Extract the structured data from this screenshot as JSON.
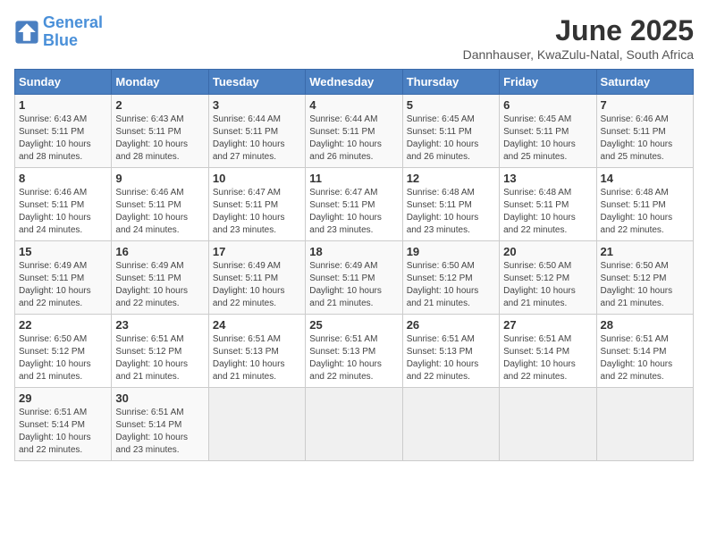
{
  "logo": {
    "line1": "General",
    "line2": "Blue"
  },
  "title": "June 2025",
  "subtitle": "Dannhauser, KwaZulu-Natal, South Africa",
  "days_of_week": [
    "Sunday",
    "Monday",
    "Tuesday",
    "Wednesday",
    "Thursday",
    "Friday",
    "Saturday"
  ],
  "weeks": [
    [
      {
        "day": "1",
        "info": "Sunrise: 6:43 AM\nSunset: 5:11 PM\nDaylight: 10 hours\nand 28 minutes."
      },
      {
        "day": "2",
        "info": "Sunrise: 6:43 AM\nSunset: 5:11 PM\nDaylight: 10 hours\nand 28 minutes."
      },
      {
        "day": "3",
        "info": "Sunrise: 6:44 AM\nSunset: 5:11 PM\nDaylight: 10 hours\nand 27 minutes."
      },
      {
        "day": "4",
        "info": "Sunrise: 6:44 AM\nSunset: 5:11 PM\nDaylight: 10 hours\nand 26 minutes."
      },
      {
        "day": "5",
        "info": "Sunrise: 6:45 AM\nSunset: 5:11 PM\nDaylight: 10 hours\nand 26 minutes."
      },
      {
        "day": "6",
        "info": "Sunrise: 6:45 AM\nSunset: 5:11 PM\nDaylight: 10 hours\nand 25 minutes."
      },
      {
        "day": "7",
        "info": "Sunrise: 6:46 AM\nSunset: 5:11 PM\nDaylight: 10 hours\nand 25 minutes."
      }
    ],
    [
      {
        "day": "8",
        "info": "Sunrise: 6:46 AM\nSunset: 5:11 PM\nDaylight: 10 hours\nand 24 minutes."
      },
      {
        "day": "9",
        "info": "Sunrise: 6:46 AM\nSunset: 5:11 PM\nDaylight: 10 hours\nand 24 minutes."
      },
      {
        "day": "10",
        "info": "Sunrise: 6:47 AM\nSunset: 5:11 PM\nDaylight: 10 hours\nand 23 minutes."
      },
      {
        "day": "11",
        "info": "Sunrise: 6:47 AM\nSunset: 5:11 PM\nDaylight: 10 hours\nand 23 minutes."
      },
      {
        "day": "12",
        "info": "Sunrise: 6:48 AM\nSunset: 5:11 PM\nDaylight: 10 hours\nand 23 minutes."
      },
      {
        "day": "13",
        "info": "Sunrise: 6:48 AM\nSunset: 5:11 PM\nDaylight: 10 hours\nand 22 minutes."
      },
      {
        "day": "14",
        "info": "Sunrise: 6:48 AM\nSunset: 5:11 PM\nDaylight: 10 hours\nand 22 minutes."
      }
    ],
    [
      {
        "day": "15",
        "info": "Sunrise: 6:49 AM\nSunset: 5:11 PM\nDaylight: 10 hours\nand 22 minutes."
      },
      {
        "day": "16",
        "info": "Sunrise: 6:49 AM\nSunset: 5:11 PM\nDaylight: 10 hours\nand 22 minutes."
      },
      {
        "day": "17",
        "info": "Sunrise: 6:49 AM\nSunset: 5:11 PM\nDaylight: 10 hours\nand 22 minutes."
      },
      {
        "day": "18",
        "info": "Sunrise: 6:49 AM\nSunset: 5:11 PM\nDaylight: 10 hours\nand 21 minutes."
      },
      {
        "day": "19",
        "info": "Sunrise: 6:50 AM\nSunset: 5:12 PM\nDaylight: 10 hours\nand 21 minutes."
      },
      {
        "day": "20",
        "info": "Sunrise: 6:50 AM\nSunset: 5:12 PM\nDaylight: 10 hours\nand 21 minutes."
      },
      {
        "day": "21",
        "info": "Sunrise: 6:50 AM\nSunset: 5:12 PM\nDaylight: 10 hours\nand 21 minutes."
      }
    ],
    [
      {
        "day": "22",
        "info": "Sunrise: 6:50 AM\nSunset: 5:12 PM\nDaylight: 10 hours\nand 21 minutes."
      },
      {
        "day": "23",
        "info": "Sunrise: 6:51 AM\nSunset: 5:12 PM\nDaylight: 10 hours\nand 21 minutes."
      },
      {
        "day": "24",
        "info": "Sunrise: 6:51 AM\nSunset: 5:13 PM\nDaylight: 10 hours\nand 21 minutes."
      },
      {
        "day": "25",
        "info": "Sunrise: 6:51 AM\nSunset: 5:13 PM\nDaylight: 10 hours\nand 22 minutes."
      },
      {
        "day": "26",
        "info": "Sunrise: 6:51 AM\nSunset: 5:13 PM\nDaylight: 10 hours\nand 22 minutes."
      },
      {
        "day": "27",
        "info": "Sunrise: 6:51 AM\nSunset: 5:14 PM\nDaylight: 10 hours\nand 22 minutes."
      },
      {
        "day": "28",
        "info": "Sunrise: 6:51 AM\nSunset: 5:14 PM\nDaylight: 10 hours\nand 22 minutes."
      }
    ],
    [
      {
        "day": "29",
        "info": "Sunrise: 6:51 AM\nSunset: 5:14 PM\nDaylight: 10 hours\nand 22 minutes."
      },
      {
        "day": "30",
        "info": "Sunrise: 6:51 AM\nSunset: 5:14 PM\nDaylight: 10 hours\nand 23 minutes."
      },
      {
        "day": "",
        "info": ""
      },
      {
        "day": "",
        "info": ""
      },
      {
        "day": "",
        "info": ""
      },
      {
        "day": "",
        "info": ""
      },
      {
        "day": "",
        "info": ""
      }
    ]
  ]
}
